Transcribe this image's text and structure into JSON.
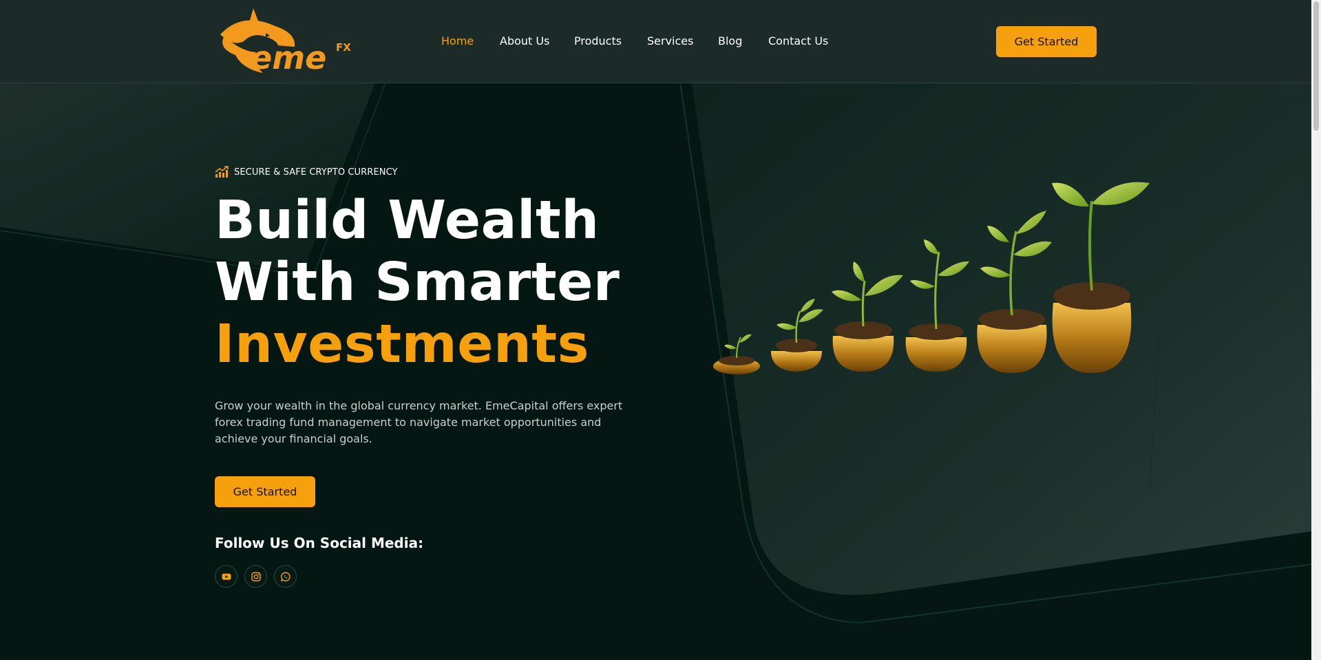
{
  "brand": {
    "logo_text": "eme",
    "logo_sup": "FX",
    "accent_color": "#f7a00d",
    "header_bg": "#1c2b27",
    "page_bg": "#041712"
  },
  "nav": {
    "items": [
      {
        "label": "Home",
        "active": true
      },
      {
        "label": "About Us",
        "active": false
      },
      {
        "label": "Products",
        "active": false
      },
      {
        "label": "Services",
        "active": false
      },
      {
        "label": "Blog",
        "active": false
      },
      {
        "label": "Contact Us",
        "active": false
      }
    ],
    "cta_label": "Get Started"
  },
  "hero": {
    "tagline": "SECURE & SAFE CRYPTO CURRENCY",
    "tagline_icon": "chart-growth-icon",
    "headline_line1": "Build Wealth",
    "headline_line2": "With Smarter",
    "headline_accent": "Investments",
    "description": "Grow your wealth in the global currency market. EmeCapital offers expert forex trading fund management to navigate market opportunities and achieve your financial goals.",
    "cta_label": "Get Started",
    "illustration": "plants-growing-from-gold-coin-pots"
  },
  "social": {
    "title": "Follow Us On Social Media:",
    "icons": [
      "youtube-icon",
      "instagram-icon",
      "whatsapp-icon"
    ]
  }
}
